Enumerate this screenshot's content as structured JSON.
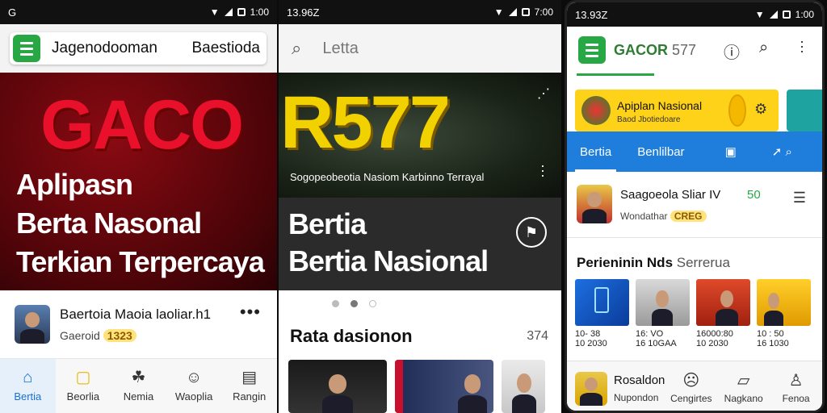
{
  "panel1": {
    "status": {
      "left": "G",
      "time": "1:00"
    },
    "header": {
      "title": "Jagenodooman",
      "right": "Baestioda"
    },
    "hero": {
      "brand": "GACO",
      "line1": "Aplipasn",
      "line2": "Berta Nasonal",
      "line3": "Terkian Terpercaya"
    },
    "row": {
      "title": "Baertoia  Maoia laoliar.h1",
      "sub": "Gaeroid",
      "badge": "1323"
    },
    "nav": [
      {
        "label": "Bertia",
        "icon": "home-icon",
        "glyph": "⌂"
      },
      {
        "label": "Beorlia",
        "icon": "chat-icon",
        "glyph": "▢"
      },
      {
        "label": "Nemia",
        "icon": "group-icon",
        "glyph": "☘"
      },
      {
        "label": "Waoplia",
        "icon": "face-icon",
        "glyph": "☺"
      },
      {
        "label": "Rangin",
        "icon": "list-icon",
        "glyph": "▤"
      }
    ]
  },
  "panel2": {
    "status": {
      "left": "13.96Z",
      "time": "7:00"
    },
    "search": {
      "placeholder": "Letta"
    },
    "hero": {
      "brand": "R577",
      "caption": "Sogopeobeotia Nasiom Karbinno Terrayal"
    },
    "band": {
      "line1": "Bertia",
      "line2": "Bertia Nasional"
    },
    "section": {
      "title": "Rata dasionon",
      "count": "374"
    }
  },
  "panel3": {
    "status": {
      "left": "13.93Z",
      "time": "1:00"
    },
    "brand": {
      "name": "GACOR",
      "num": "577"
    },
    "banner": {
      "title": "Apiplan Nasional",
      "sub": "Baod Jbotiedoare"
    },
    "tabs": [
      {
        "label": "Bertia",
        "active": true
      },
      {
        "label": "Benlilbar",
        "active": false
      },
      {
        "label": "▣",
        "active": false
      },
      {
        "label": "➚ ⌕",
        "active": false
      }
    ],
    "item": {
      "title": "Saagoeola  Sliar IV",
      "num": "50",
      "sub": "Wondathar",
      "badge": "CREG"
    },
    "section": {
      "title": "Perieninin Nds",
      "sub": "Serrerua"
    },
    "grid": [
      {
        "l1": "10- 38",
        "l2": "10 2030"
      },
      {
        "l1": "16:  VO",
        "l2": "16 10GAA"
      },
      {
        "l1": "16000:80",
        "l2": "10 2030"
      },
      {
        "l1": "10 : 50",
        "l2": "16 1030"
      }
    ],
    "nav": [
      {
        "label": "Nupondon",
        "title": "Rosaldon",
        "icon": "avatar"
      },
      {
        "label": "Cengirtes",
        "icon": "face-sad-icon",
        "glyph": "☹"
      },
      {
        "label": "Nagkano",
        "icon": "bookmark-icon",
        "glyph": "▱"
      },
      {
        "label": "Fenoa",
        "icon": "person-icon",
        "glyph": "♙"
      }
    ]
  }
}
